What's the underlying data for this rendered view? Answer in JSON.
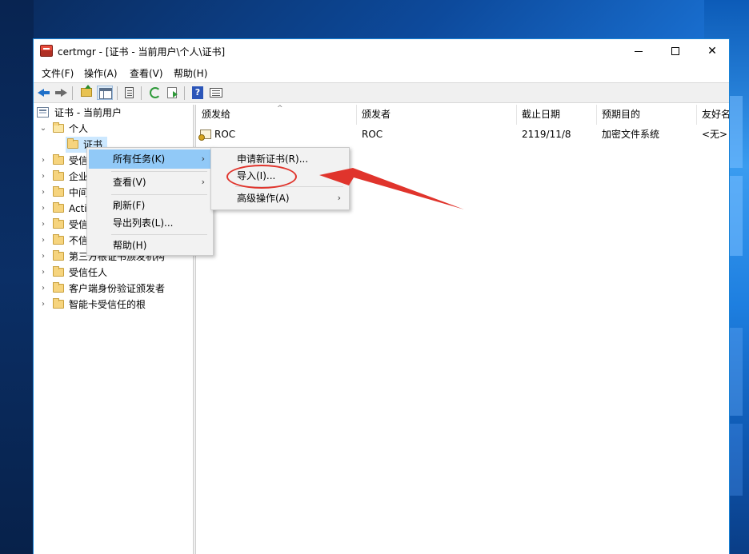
{
  "window": {
    "title": "certmgr - [证书 - 当前用户\\个人\\证书]",
    "controls": {
      "minimize": "—",
      "maximize": "☐",
      "close": "✕"
    }
  },
  "menubar": {
    "items": [
      {
        "label": "文件(F)"
      },
      {
        "label": "操作(A)"
      },
      {
        "label": "查看(V)"
      },
      {
        "label": "帮助(H)"
      }
    ]
  },
  "toolbar": {
    "icons": [
      "back-arrow-icon",
      "forward-arrow-icon",
      "up-folder-icon",
      "show-hide-console-tree-icon",
      "copy-icon",
      "refresh-icon",
      "export-list-icon",
      "help-icon",
      "properties-icon"
    ],
    "help_glyph": "?"
  },
  "tree": {
    "root": "证书 - 当前用户",
    "personal": "个人",
    "certificates": "证书",
    "truncated_items": [
      "受信",
      "企业",
      "中间",
      "Acti",
      "受信",
      "不信"
    ],
    "items": [
      {
        "label": "第三方根证书颁发机构"
      },
      {
        "label": "受信任人"
      },
      {
        "label": "客户端身份验证颁发者"
      },
      {
        "label": "智能卡受信任的根"
      }
    ]
  },
  "list": {
    "columns": [
      "颁发给",
      "颁发者",
      "截止日期",
      "预期目的",
      "友好名"
    ],
    "rows": [
      {
        "issued_to": "ROC",
        "issued_by": "ROC",
        "expiration": "2119/11/8",
        "purpose": "加密文件系统",
        "friendly_name": "<无>"
      }
    ]
  },
  "context_menu": {
    "items": [
      {
        "label": "所有任务(K)",
        "submenu": true,
        "highlighted": true
      },
      {
        "label": "查看(V)",
        "submenu": true
      },
      {
        "label": "刷新(F)"
      },
      {
        "label": "导出列表(L)..."
      },
      {
        "label": "帮助(H)"
      }
    ],
    "submenu_arrow": "›"
  },
  "submenu": {
    "items": [
      {
        "label": "申请新证书(R)..."
      },
      {
        "label": "导入(I)..."
      },
      {
        "label": "高级操作(A)",
        "submenu": true
      }
    ]
  },
  "annotation": {
    "color": "#e0342c"
  },
  "colors": {
    "menu_highlight": "#91c9f7",
    "tree_selection": "#cce8ff",
    "window_border": "#1883d7"
  }
}
